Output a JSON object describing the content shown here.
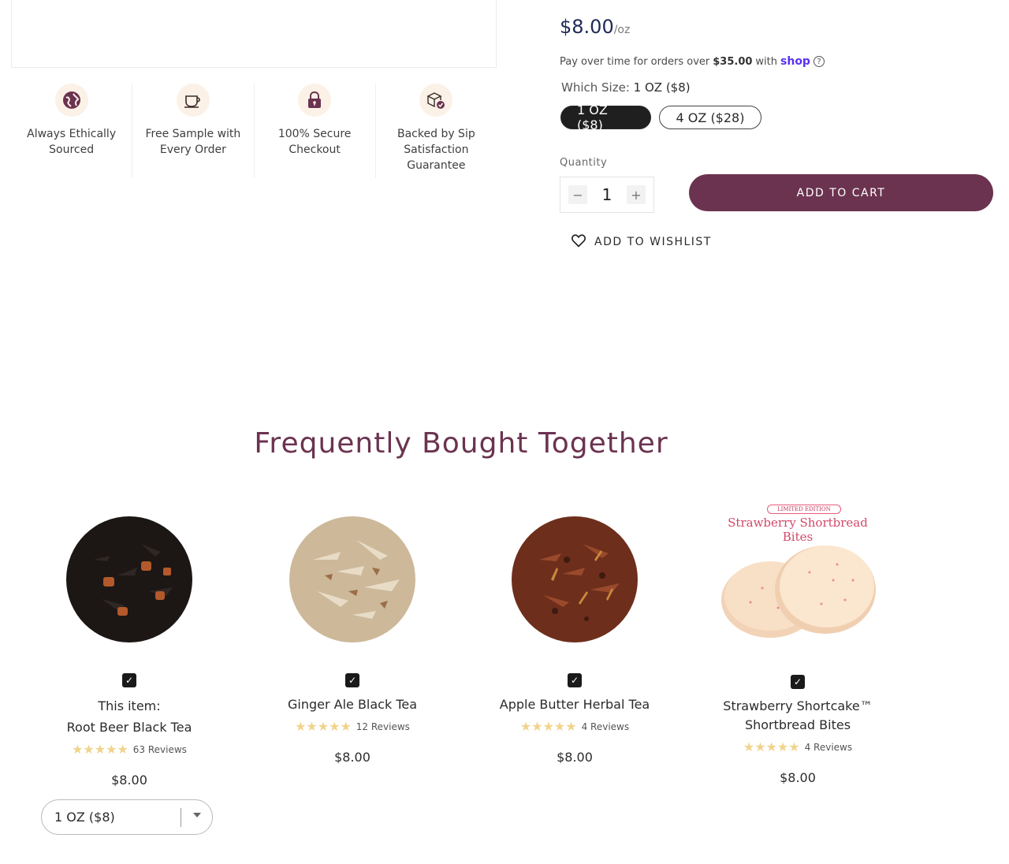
{
  "features": [
    {
      "icon": "globe-icon",
      "label": "Always Ethically Sourced",
      "line1": "Always Ethically",
      "line2": "Sourced",
      "line3": ""
    },
    {
      "icon": "teacup-icon",
      "label": "Free Sample with Every Order",
      "line1": "Free Sample with",
      "line2": "Every Order",
      "line3": ""
    },
    {
      "icon": "lock-icon",
      "label": "100% Secure Checkout",
      "line1": "100% Secure",
      "line2": "Checkout",
      "line3": ""
    },
    {
      "icon": "box-check-icon",
      "label": "Backed by Sip Satisfaction Guarantee",
      "line1": "Backed by Sip",
      "line2": "Satisfaction",
      "line3": "Guarantee"
    }
  ],
  "buy_box": {
    "price": "$8.00",
    "price_unit": "/oz",
    "installments_prefix": "Pay over time for orders over",
    "installments_amount": "$35.00",
    "installments_with": "with",
    "installments_brand": "shop",
    "size_label": "Which Size:",
    "size_selected": "1 OZ ($8)",
    "sizes": [
      "1 OZ ($8)",
      "4 OZ ($28)"
    ],
    "quantity_label": "Quantity",
    "quantity": "1",
    "minus": "−",
    "plus": "+",
    "add_to_cart": "ADD TO CART",
    "wishlist": "ADD TO WISHLIST"
  },
  "fbt": {
    "title": "Frequently Bought Together",
    "products": [
      {
        "prefix": "This item:",
        "name": "Root Beer Black Tea",
        "name_line2": "",
        "stars": "★★★★★",
        "reviews": "63 Reviews",
        "price": "$8.00",
        "checked": true
      },
      {
        "prefix": "",
        "name": "Ginger Ale Black Tea",
        "name_line2": "",
        "stars": "★★★★★",
        "reviews": "12 Reviews",
        "price": "$8.00",
        "checked": true
      },
      {
        "prefix": "",
        "name": "Apple Butter Herbal Tea",
        "name_line2": "",
        "stars": "★★★★★",
        "reviews": "4 Reviews",
        "price": "$8.00",
        "checked": true
      },
      {
        "prefix": "",
        "name": "Strawberry Shortcake™",
        "name_line2": "Shortbread Bites",
        "stars": "★★★★★",
        "reviews": "4 Reviews",
        "price": "$8.00",
        "checked": true
      }
    ],
    "select_value": "1 OZ ($8)",
    "shortbread_badge": "LIMITED EDITION",
    "shortbread_title": "Strawberry Shortbread Bites",
    "check_mark": "✓"
  },
  "colors": {
    "accent": "#6b3350",
    "price": "#1f2a55",
    "star": "#f0d38c",
    "shop": "#5a31f4"
  }
}
